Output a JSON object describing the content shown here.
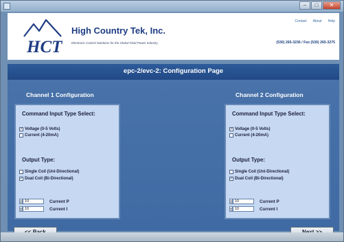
{
  "header": {
    "company": "High Country Tek, Inc.",
    "tagline": "Electronic Control Solutions for the Global Fluid Power Industry",
    "links": [
      "Contact",
      "About",
      "Help"
    ],
    "phone": "(530) 265-3236 / Fax (530) 265-3275",
    "logo_text": "HCT"
  },
  "page_title": "epc-2/evc-2: Configuration Page",
  "channels": [
    {
      "heading": "Channel 1 Configuration",
      "command_title": "Command Input Type Select:",
      "voltage_label": "Voltage (0-5 Volts)",
      "voltage_checked": true,
      "current_label": "Current (4-20mA)",
      "current_checked": false,
      "output_title": "Output Type:",
      "single_label": "Single Coil (Uni-Directional)",
      "single_checked": false,
      "dual_label": "Dual Coil (Bi-Directional)",
      "dual_checked": true,
      "current_p_value": "10",
      "current_p_label": "Current P",
      "current_i_value": "10",
      "current_i_label": "Current I"
    },
    {
      "heading": "Channel 2 Configuration",
      "command_title": "Command Input Type Select:",
      "voltage_label": "Voltage (0-5 Volts)",
      "voltage_checked": true,
      "current_label": "Current (4-20mA)",
      "current_checked": false,
      "output_title": "Output Type:",
      "single_label": "Single Coil (Uni-Directional)",
      "single_checked": false,
      "dual_label": "Dual Coil (Bi-Directional)",
      "dual_checked": true,
      "current_p_value": "10",
      "current_p_label": "Current P",
      "current_i_value": "10",
      "current_i_label": "Current I"
    }
  ],
  "nav": {
    "back_label": "<< Back",
    "next_label": "Next >>"
  },
  "icons": {
    "check_mark": "✓",
    "spin_up": "▴",
    "spin_down": "▾"
  },
  "colors": {
    "brand_blue": "#1e3c83",
    "page_bg": "#3f6aa3",
    "panel_bg": "#c6d8f2"
  }
}
